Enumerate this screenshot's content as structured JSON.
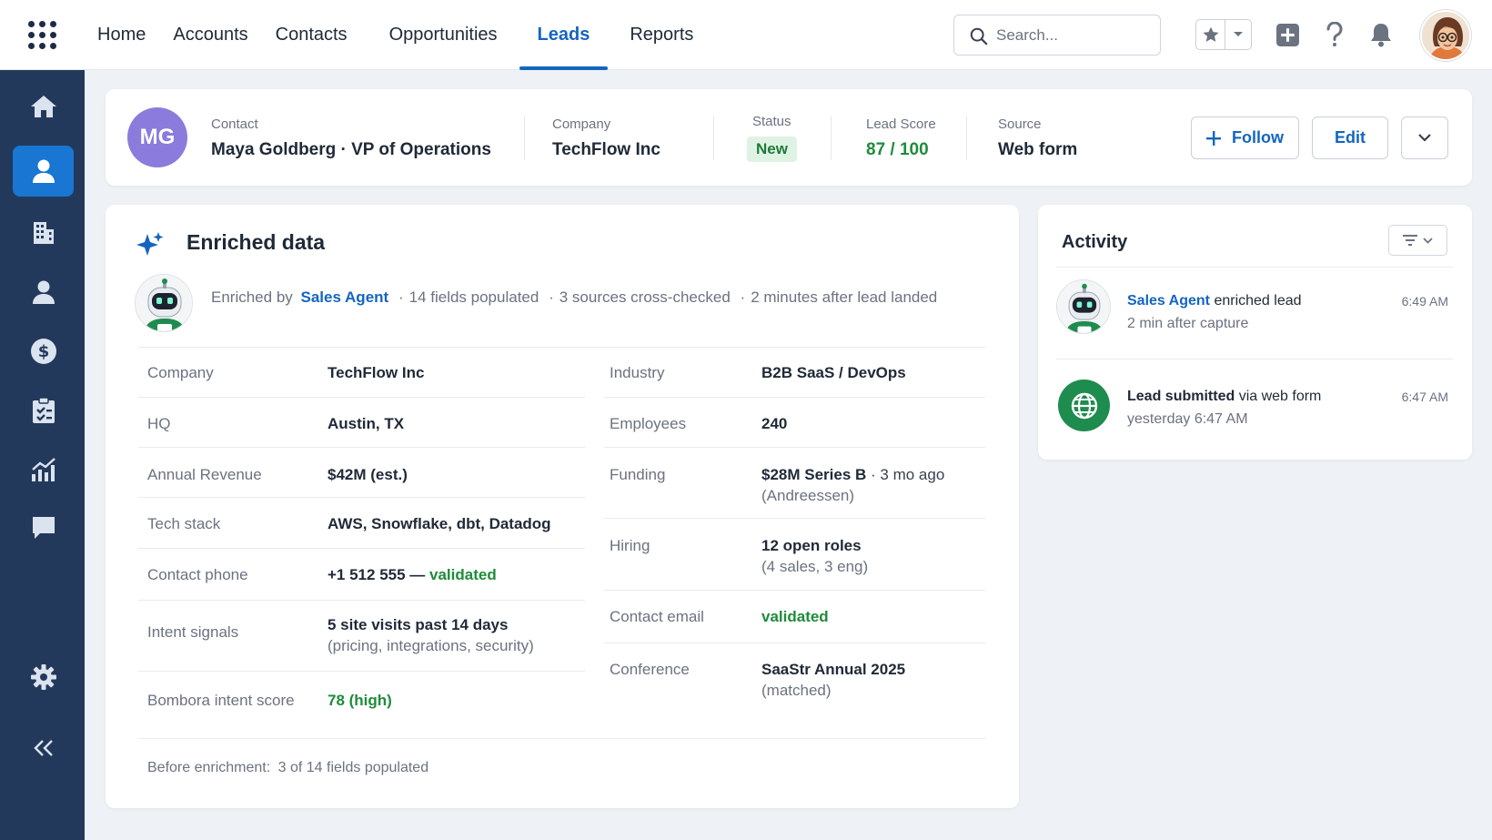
{
  "nav": {
    "links": [
      "Home",
      "Accounts",
      "Contacts",
      "Opportunities",
      "Leads",
      "Reports"
    ],
    "active": "Leads",
    "search_placeholder": "Search..."
  },
  "lead": {
    "initials": "MG",
    "contact_label": "Contact",
    "contact_value": "Maya Goldberg · VP of Operations",
    "company_label": "Company",
    "company_value": "TechFlow Inc",
    "status_label": "Status",
    "status_value": "New",
    "score_label": "Lead Score",
    "score_value": "87 / 100",
    "source_label": "Source",
    "source_value": "Web form",
    "follow_label": "Follow",
    "edit_label": "Edit"
  },
  "enriched": {
    "title": "Enriched data",
    "enriched_by": "Enriched by",
    "agent": "Sales Agent",
    "meta": [
      "14 fields populated",
      "3 sources cross-checked",
      "2 minutes after lead landed"
    ],
    "left": [
      {
        "label": "Company",
        "value": "TechFlow Inc"
      },
      {
        "label": "HQ",
        "value": "Austin, TX"
      },
      {
        "label": "Annual Revenue",
        "value": "$42M (est.)"
      },
      {
        "label": "Tech stack",
        "value": "AWS, Snowflake, dbt, Datadog"
      },
      {
        "label": "Contact phone",
        "value": "+1 512 555 —",
        "value_green": "validated"
      },
      {
        "label": "Intent signals",
        "value": "5 site visits past 14 days",
        "sub": "(pricing, integrations, security)"
      },
      {
        "label": "Bombora intent score",
        "value_green": "78 (high)"
      }
    ],
    "right": [
      {
        "label": "Industry",
        "value": "B2B SaaS / DevOps"
      },
      {
        "label": "Employees",
        "value": "240"
      },
      {
        "label": "Funding",
        "value": "$28M Series B",
        "inline_sub": " · 3 mo ago",
        "sub": "(Andreessen)"
      },
      {
        "label": "Hiring",
        "value": "12 open roles",
        "sub": "(4 sales, 3 eng)"
      },
      {
        "label": "Contact email",
        "value_green": "validated"
      },
      {
        "label": "Conference",
        "value": "SaaStr Annual 2025",
        "sub": "(matched)"
      }
    ],
    "before_label": "Before enrichment:",
    "before_value": "3 of 14 fields populated"
  },
  "activity": {
    "title": "Activity",
    "items": [
      {
        "actor": "Sales Agent",
        "action": "enriched lead",
        "detail": "2 min after capture",
        "time": "6:49 AM"
      },
      {
        "actor": "Lead submitted",
        "action": "via web form",
        "detail": "yesterday 6:47 AM",
        "time": "6:47 AM"
      }
    ]
  },
  "colors": {
    "accent": "#1565c0",
    "sidebar": "#23395c",
    "success": "#1e8c3a",
    "avatar": "#8b7bdc"
  }
}
